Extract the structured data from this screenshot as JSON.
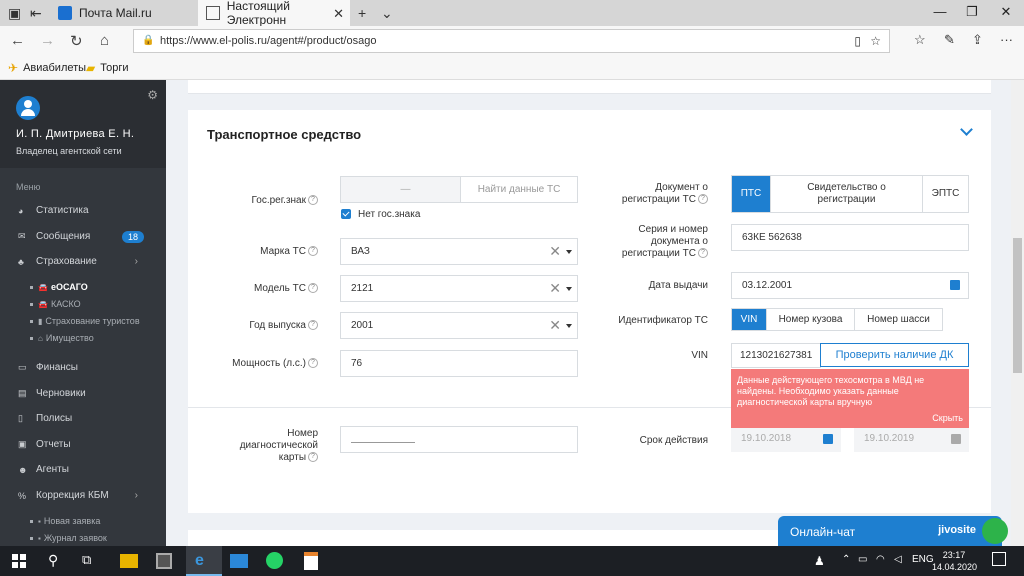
{
  "browser": {
    "tabs": [
      {
        "title": "Почта Mail.ru",
        "active": false,
        "icon": "mail-icon"
      },
      {
        "title": "Настоящий Электронн",
        "active": true,
        "icon": "page-icon"
      }
    ],
    "url": "https://www.el-polis.ru/agent#/product/osago",
    "bookmarks": [
      {
        "label": "Авиабилеты",
        "icon": "plane-icon"
      },
      {
        "label": "Торги",
        "icon": "folder-icon"
      }
    ]
  },
  "sidebar": {
    "user_name": "И. П. Дмитриева Е. Н.",
    "user_role": "Владелец агентской сети",
    "menu_title": "Меню",
    "items": [
      {
        "label": "Статистика",
        "icon": "chart-icon"
      },
      {
        "label": "Сообщения",
        "icon": "mail-icon",
        "badge": "18"
      },
      {
        "label": "Страхование",
        "icon": "shield-icon"
      },
      {
        "label": "Финансы",
        "icon": "money-icon"
      },
      {
        "label": "Черновики",
        "icon": "draft-icon"
      },
      {
        "label": "Полисы",
        "icon": "doc-icon"
      },
      {
        "label": "Отчеты",
        "icon": "report-icon"
      },
      {
        "label": "Агенты",
        "icon": "users-icon"
      },
      {
        "label": "Коррекция КБМ",
        "icon": "percent-icon"
      }
    ],
    "insurance_sub": [
      "еОСАГО",
      "КАСКО",
      "Страхование туристов",
      "Имущество"
    ],
    "kbm_sub": [
      "Новая заявка",
      "Журнал заявок"
    ]
  },
  "section": {
    "title": "Транспортное средство",
    "left": {
      "reg_label": "Гос.рег.знак",
      "reg_placeholder": "—",
      "find_button": "Найти данные ТС",
      "no_plate_label": "Нет гос.знака",
      "brand_label": "Марка ТС",
      "brand_value": "ВАЗ",
      "model_label": "Модель ТС",
      "model_value": "2121",
      "year_label": "Год выпуска",
      "year_value": "2001",
      "power_label": "Мощность (л.с.)",
      "power_value": "76",
      "diag_label": "Номер диагностической карты"
    },
    "right": {
      "doc_label": "Документ о регистрации ТС",
      "doc_options": [
        "ПТС",
        "Свидетельство о регистрации",
        "ЭПТС"
      ],
      "series_label": "Серия и номер документа о регистрации ТС",
      "series_value": "63КЕ 562638",
      "issue_label": "Дата выдачи",
      "issue_value": "03.12.2001",
      "id_label": "Идентификатор ТС",
      "id_options": [
        "VIN",
        "Номер кузова",
        "Номер шасси"
      ],
      "vin_label": "VIN",
      "vin_value": "1213021627381",
      "check_button": "Проверить наличие ДК",
      "alert_text": "Данные действующего техосмотра в МВД не найдены. Необходимо указать данные диагностической карты вручную",
      "alert_hide": "Скрыть",
      "validity_label": "Срок действия",
      "validity_from": "19.10.2018",
      "validity_to": "19.10.2019"
    }
  },
  "chat": {
    "label": "Онлайн-чат",
    "brand": "jivosite"
  },
  "taskbar": {
    "lang": "ENG",
    "time": "23:17",
    "date": "14.04.2020"
  }
}
